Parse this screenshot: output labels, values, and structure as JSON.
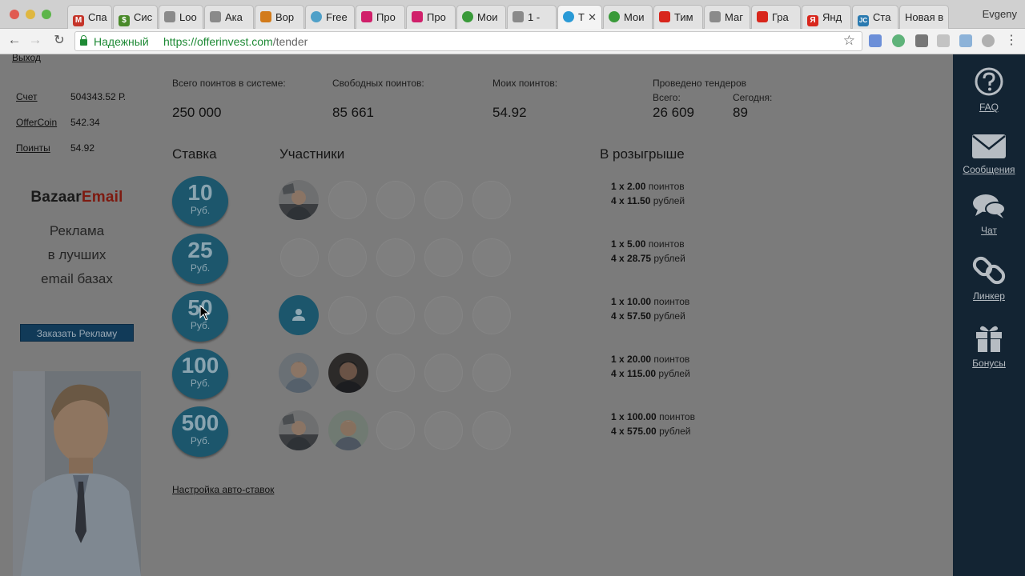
{
  "browser": {
    "tabs": [
      {
        "label": "Спа",
        "fav_color": "#c5352a",
        "fav_char": "M"
      },
      {
        "label": "Сис",
        "fav_color": "#4a8a2a",
        "fav_char": "$"
      },
      {
        "label": "Loo",
        "fav_color": "#8a8a8a",
        "fav_char": ""
      },
      {
        "label": "Ака",
        "fav_color": "#8a8a8a",
        "fav_char": ""
      },
      {
        "label": "Вор",
        "fav_color": "#d27b1b",
        "fav_char": ""
      },
      {
        "label": "Free",
        "fav_color": "#4fa0c8",
        "fav_char": ""
      },
      {
        "label": "Про",
        "fav_color": "#d0206a",
        "fav_char": ""
      },
      {
        "label": "Про",
        "fav_color": "#d0206a",
        "fav_char": ""
      },
      {
        "label": "Мои",
        "fav_color": "#3a9a3a",
        "fav_char": ""
      },
      {
        "label": "1 -",
        "fav_color": "#8a8a8a",
        "fav_char": ""
      },
      {
        "label": "Т",
        "fav_color": "#2a9ad6",
        "fav_char": ""
      },
      {
        "label": "Мои",
        "fav_color": "#3a9a3a",
        "fav_char": ""
      },
      {
        "label": "Тим",
        "fav_color": "#d8261c",
        "fav_char": ""
      },
      {
        "label": "Маг",
        "fav_color": "#8a8a8a",
        "fav_char": ""
      },
      {
        "label": "Гра",
        "fav_color": "#d8261c",
        "fav_char": ""
      },
      {
        "label": "Янд",
        "fav_color": "#d8261c",
        "fav_char": "Я"
      },
      {
        "label": "Ста",
        "fav_color": "#2a7ab0",
        "fav_char": "JC"
      },
      {
        "label": "Новая в",
        "fav_color": "",
        "fav_char": ""
      }
    ],
    "profile": "Evgeny",
    "secure_label": "Надежный",
    "url_host": "https://offerinvest.com",
    "url_path": "/tender"
  },
  "left": {
    "logout": "Выход",
    "account": [
      {
        "label": "Счет",
        "value": "504343.52 Р."
      },
      {
        "label": "OfferCoin",
        "value": "542.34"
      },
      {
        "label": "Поинты",
        "value": "54.92"
      }
    ],
    "ad": {
      "brand_a": "Bazaar",
      "brand_b": "Email",
      "line1": "Реклама",
      "line2": "в лучших",
      "line3": "email базах",
      "button": "Заказать Рекламу"
    }
  },
  "stats": {
    "total_label": "Всего поинтов в системе:",
    "total_value": "250 000",
    "free_label": "Свободных поинтов:",
    "free_value": "85 661",
    "mine_label": "Моих поинтов:",
    "mine_value": "54.92",
    "tenders_label": "Проведено тендеров",
    "all_label": "Всего:",
    "all_value": "26 609",
    "today_label": "Сегодня:",
    "today_value": "89"
  },
  "table": {
    "col_bid": "Ставка",
    "col_participants": "Участники",
    "col_prize": "В розыгрыше",
    "currency": "Руб.",
    "rows": [
      {
        "bid": "10",
        "p1": "1 x 2.00",
        "p1u": "поинтов",
        "p2": "4 x 11.50",
        "p2u": "рублей"
      },
      {
        "bid": "25",
        "p1": "1 x 5.00",
        "p1u": "поинтов",
        "p2": "4 x 28.75",
        "p2u": "рублей"
      },
      {
        "bid": "50",
        "p1": "1 x 10.00",
        "p1u": "поинтов",
        "p2": "4 x 57.50",
        "p2u": "рублей"
      },
      {
        "bid": "100",
        "p1": "1 x 20.00",
        "p1u": "поинтов",
        "p2": "4 x 115.00",
        "p2u": "рублей"
      },
      {
        "bid": "500",
        "p1": "1 x 100.00",
        "p1u": "поинтов",
        "p2": "4 x 575.00",
        "p2u": "рублей"
      }
    ],
    "auto_bid_link": "Настройка авто-ставок"
  },
  "right_sidebar": {
    "faq": "FAQ",
    "messages": "Сообщения",
    "chat": "Чат",
    "linker": "Линкер",
    "bonuses": "Бонусы"
  }
}
